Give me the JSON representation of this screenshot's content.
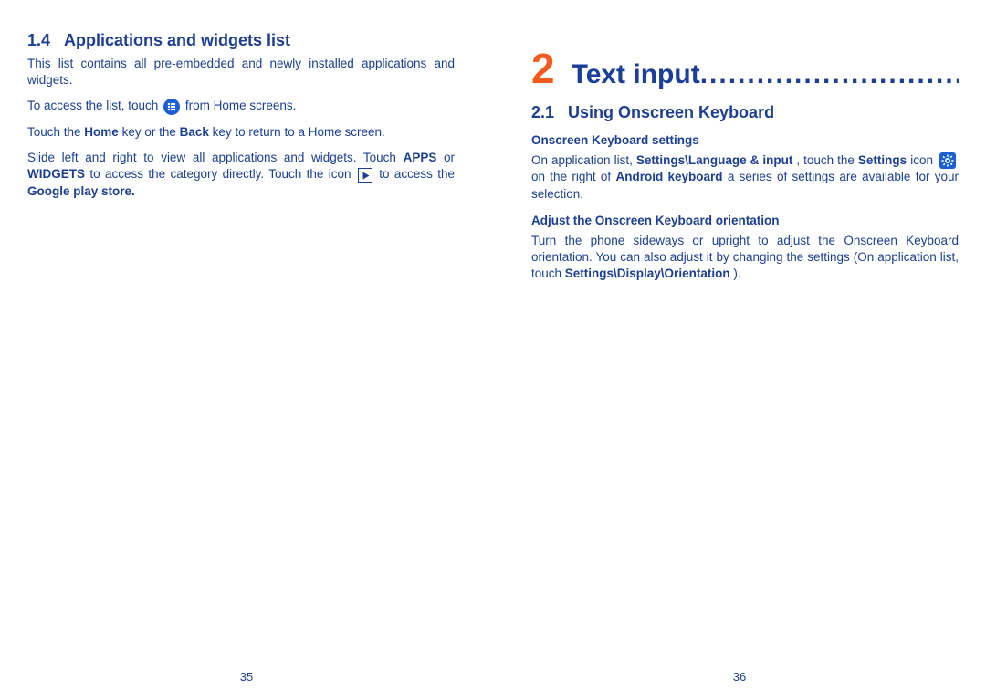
{
  "left": {
    "section_number": "1.4",
    "section_title": "Applications and widgets list",
    "para1": "This list contains all pre-embedded and newly installed applications and widgets.",
    "para2_a": "To access the list, touch ",
    "para2_b": " from Home screens.",
    "para3_a": "Touch the ",
    "para3_home": "Home",
    "para3_b": " key or the ",
    "para3_back": "Back",
    "para3_c": " key to return to a Home screen.",
    "para4_a": "Slide left and right to view all applications and widgets. Touch ",
    "para4_apps": "APPS",
    "para4_b": " or ",
    "para4_widgets": "WIDGETS",
    "para4_c": " to access the category directly. Touch the icon ",
    "para4_d": " to access the ",
    "para4_store": "Google play store.",
    "page_number": "35"
  },
  "right": {
    "chapter_number": "2",
    "chapter_title": "Text input",
    "chapter_dots": "..............................",
    "section_number": "2.1",
    "section_title": "Using Onscreen Keyboard",
    "sub1": "Onscreen Keyboard settings",
    "p1_a": "On application list, ",
    "p1_path": "Settings\\Language & input",
    "p1_b": ", touch the ",
    "p1_settings": "Settings",
    "p1_c": " icon ",
    "p1_d": " on the right of ",
    "p1_android": "Android keyboard",
    "p1_e": " a series of settings are available for your selection.",
    "sub2": "Adjust the Onscreen Keyboard orientation",
    "p2_a": "Turn the phone sideways or upright to adjust the Onscreen Keyboard orientation. You can also adjust it by changing the settings (On application list, touch ",
    "p2_path": "Settings\\Display\\Orientation",
    "p2_b": ").",
    "page_number": "36"
  }
}
